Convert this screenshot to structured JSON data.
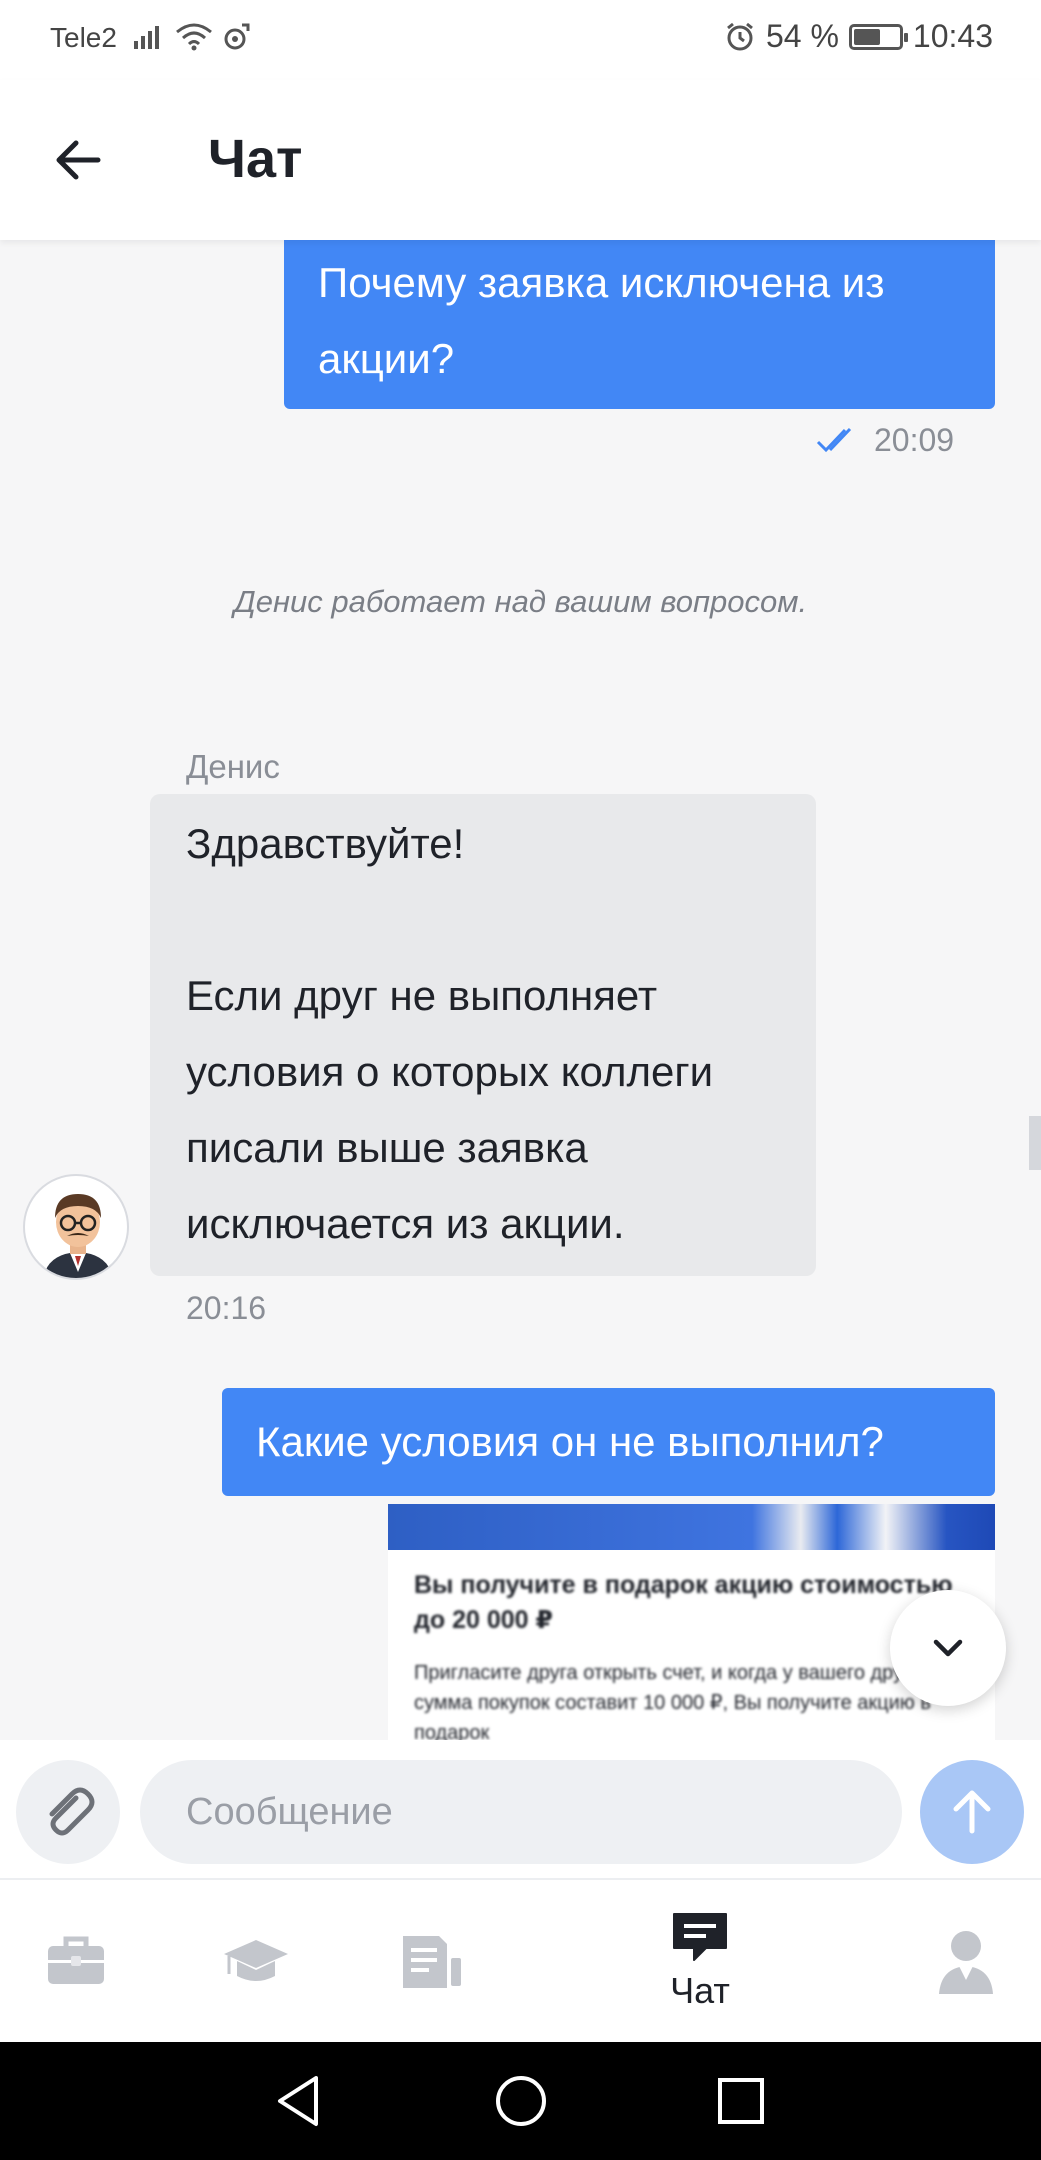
{
  "status_bar": {
    "carrier": "Tele2",
    "battery": "54 %",
    "battery_level": 0.54,
    "time": "10:43"
  },
  "header": {
    "title": "Чат"
  },
  "chat": {
    "messages": [
      {
        "text": "Почему заявка исключена из акции?",
        "time": "20:09"
      },
      {
        "system": "Денис работает над вашим вопросом."
      },
      {
        "sender": "Денис",
        "greeting": "Здравствуйте!",
        "text": "Если друг не выполняет условия о которых коллеги писали выше заявка исключается из акции.",
        "time": "20:16"
      },
      {
        "text": "Какие условия он не выполнил?"
      }
    ],
    "attachment": {
      "title": "Вы получите в подарок акцию стоимостью до 20 000 ₽",
      "body": "Пригласите друга открыть счет, и когда у вашего друга сумма покупок составит 10 000 ₽, Вы получите акцию в подарок"
    }
  },
  "composer": {
    "placeholder": "Сообщение"
  },
  "tabbar": {
    "tabs": [
      {
        "icon": "briefcase-icon",
        "label": ""
      },
      {
        "icon": "graduation-cap-icon",
        "label": ""
      },
      {
        "icon": "document-icon",
        "label": ""
      },
      {
        "icon": "chat-icon",
        "label": "Чат",
        "active": true
      },
      {
        "icon": "profile-icon",
        "label": ""
      }
    ]
  },
  "colors": {
    "accent": "#4287f5",
    "incoming_bubble": "#e8e9eb",
    "send_disabled": "#a9c7f6",
    "chat_bg": "#f6f6f7"
  }
}
